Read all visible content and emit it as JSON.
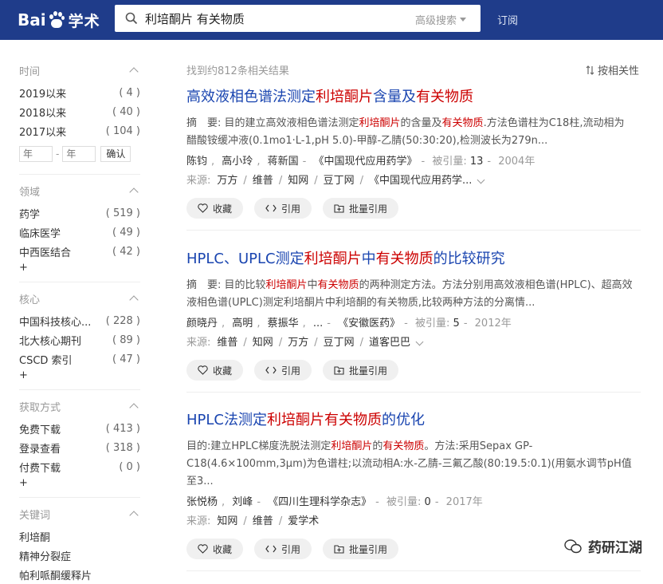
{
  "header": {
    "logo_left": "Bai",
    "logo_right": "学术",
    "search_query": "利培酮片 有关物质",
    "advanced_search": "高级搜索",
    "subscribe": "订阅"
  },
  "sidebar": {
    "time": {
      "title": "时间",
      "items": [
        {
          "label": "2019以来",
          "count": "( 4 )"
        },
        {
          "label": "2018以来",
          "count": "( 40 )"
        },
        {
          "label": "2017以来",
          "count": "( 104 )"
        }
      ],
      "year_from_placeholder": "年",
      "year_to_placeholder": "年",
      "confirm": "确认"
    },
    "field": {
      "title": "领域",
      "items": [
        {
          "label": "药学",
          "count": "( 519 )"
        },
        {
          "label": "临床医学",
          "count": "( 49 )"
        },
        {
          "label": "中西医结合",
          "count": "( 42 )"
        }
      ],
      "more": "+"
    },
    "core": {
      "title": "核心",
      "items": [
        {
          "label": "中国科技核心...",
          "count": "( 228 )"
        },
        {
          "label": "北大核心期刊",
          "count": "( 89 )"
        },
        {
          "label": "CSCD 索引",
          "count": "( 47 )"
        }
      ],
      "more": "+"
    },
    "access": {
      "title": "获取方式",
      "items": [
        {
          "label": "免费下载",
          "count": "( 413 )"
        },
        {
          "label": "登录查看",
          "count": "( 318 )"
        },
        {
          "label": "付费下载",
          "count": "( 0 )"
        }
      ],
      "more": "+"
    },
    "keywords": {
      "title": "关键词",
      "items": [
        "利培酮",
        "精神分裂症",
        "帕利哌酮缓释片"
      ]
    }
  },
  "main": {
    "result_count": "找到约812条相关结果",
    "sort": "按相关性",
    "results": [
      {
        "title": [
          "高效液相色谱法测定",
          "利培酮片",
          "含量及",
          "有关物质",
          ""
        ],
        "abstract": [
          "摘　要: 目的建立高效液相色谱法测定",
          "利培酮片",
          "的含量及",
          "有关物质",
          ".方法色谱柱为C18柱,流动相为醋酸铵缓冲液(0.1mo1·L-1,pH 5.0)-甲醇-乙腈(50:30:20),检测波长为279n..."
        ],
        "authors": [
          "陈钧",
          "高小玲",
          "蒋新国"
        ],
        "journal": "《中国现代应用药学》",
        "cited_label": "被引量:",
        "cited": "13",
        "year": "2004年",
        "source_label": "来源:",
        "sources": [
          "万方",
          "维普",
          "知网",
          "豆丁网",
          "《中国现代应用药学..."
        ],
        "has_more_sources": true
      },
      {
        "title": [
          "HPLC、UPLC测定",
          "利培酮片",
          "中",
          "有关物质",
          "的比较研究"
        ],
        "abstract": [
          "摘　要: 目的比较",
          "利培酮片",
          "中",
          "有关物质",
          "的两种测定方法。方法分别用高效液相色谱(HPLC)、超高效液相色谱(UPLC)测定利培酮片中利培酮的有关物质,比较两种方法的分离情..."
        ],
        "authors": [
          "颜晓丹",
          "高明",
          "蔡振华",
          "..."
        ],
        "journal": "《安徽医药》",
        "cited_label": "被引量:",
        "cited": "5",
        "year": "2012年",
        "source_label": "来源:",
        "sources": [
          "维普",
          "知网",
          "万方",
          "豆丁网",
          "道客巴巴"
        ],
        "has_more_sources": true
      },
      {
        "title": [
          "HPLC法测定",
          "利培酮片",
          "",
          "有关物质",
          "的优化"
        ],
        "abstract": [
          "目的:建立HPLC梯度洗脱法测定",
          "利培酮片",
          "的",
          "有关物质",
          "。方法:采用Sepax GP-C18(4.6×100mm,3μm)为色谱柱;以流动相A:水-乙腈-三氟乙酸(80:19.5:0.1)(用氨水调节pH值至3..."
        ],
        "authors": [
          "张悦杨",
          "刘峰"
        ],
        "journal": "《四川生理科学杂志》",
        "cited_label": "被引量:",
        "cited": "0",
        "year": "2017年",
        "source_label": "来源:",
        "sources": [
          "知网",
          "维普",
          "爱学术"
        ],
        "has_more_sources": false
      }
    ],
    "actions": {
      "collect": "收藏",
      "cite": "引用",
      "batch_cite": "批量引用"
    }
  },
  "watermark": "药研江湖",
  "colors": {
    "header_bg": "#1f3c8a",
    "title_link": "#1a45b0",
    "highlight": "#cc0000"
  }
}
